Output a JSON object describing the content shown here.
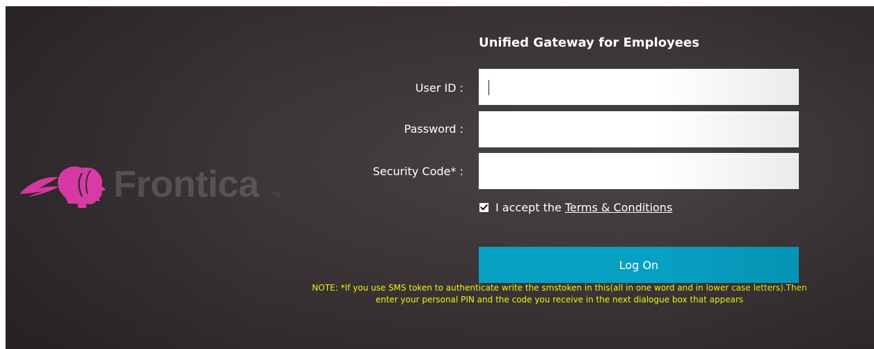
{
  "brand": {
    "name": "Frontica",
    "trademark": "TM",
    "accent_color": "#ec3fb4"
  },
  "form": {
    "title": "Unified Gateway for Employees",
    "user_id_label": "User ID :",
    "user_id_value": "",
    "password_label": "Password :",
    "password_value": "",
    "security_code_label": "Security Code* :",
    "security_code_value": "",
    "accept_checked": true,
    "accept_text": "I accept the",
    "terms_link": "Terms & Conditions",
    "logon_label": "Log On",
    "button_color": "#07a0c3"
  },
  "note": {
    "text": "NOTE: *If you use SMS token to authenticate write the smstoken in this(all in one word and in lower case letters).Then enter your personal PIN and the code you receive in the next dialogue box that appears",
    "color": "#f3f10e"
  },
  "icons": {
    "logo": "frontica-faces-logo-icon",
    "check": "checkmark-icon"
  }
}
